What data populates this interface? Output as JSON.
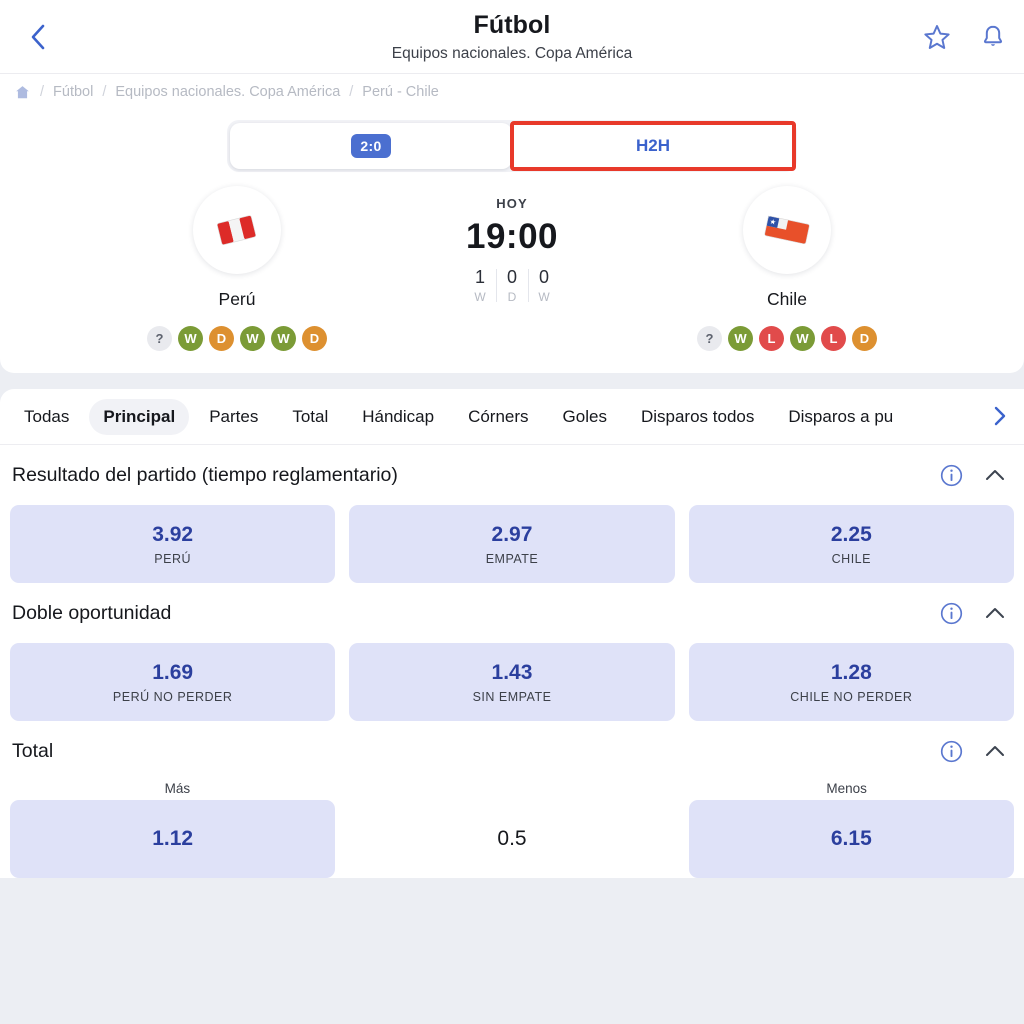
{
  "header": {
    "back_icon": "chevron-left-icon",
    "title": "Fútbol",
    "subtitle": "Equipos nacionales. Copa América",
    "favorite_icon": "star-icon",
    "notification_icon": "bell-icon"
  },
  "breadcrumb": {
    "home_icon": "home-icon",
    "sep": "/",
    "items": [
      {
        "label": "Fútbol"
      },
      {
        "label": "Equipos nacionales. Copa América"
      },
      {
        "label": "Perú - Chile"
      }
    ]
  },
  "segmented": {
    "tabs": [
      {
        "label": "2:0",
        "type": "score-badge",
        "active": true
      },
      {
        "label": "H2H",
        "type": "text",
        "active": false,
        "annotated": true
      }
    ]
  },
  "match": {
    "day_label": "HOY",
    "kickoff": "19:00",
    "stats": [
      {
        "value": "1",
        "key": "W"
      },
      {
        "value": "0",
        "key": "D"
      },
      {
        "value": "0",
        "key": "W"
      }
    ],
    "home": {
      "name": "Perú",
      "flag_icon": "peru-flag-icon",
      "form": [
        "?",
        "W",
        "D",
        "W",
        "W",
        "D"
      ]
    },
    "away": {
      "name": "Chile",
      "flag_icon": "chile-flag-icon",
      "form": [
        "?",
        "W",
        "L",
        "W",
        "L",
        "D"
      ]
    }
  },
  "market_tabs": [
    {
      "label": "Todas",
      "active": false
    },
    {
      "label": "Principal",
      "active": true
    },
    {
      "label": "Partes",
      "active": false
    },
    {
      "label": "Total",
      "active": false
    },
    {
      "label": "Hándicap",
      "active": false
    },
    {
      "label": "Córners",
      "active": false
    },
    {
      "label": "Goles",
      "active": false
    },
    {
      "label": "Disparos todos",
      "active": false
    },
    {
      "label": "Disparos a pu",
      "active": false
    }
  ],
  "market_tabs_more_icon": "chevron-right-icon",
  "markets": [
    {
      "title": "Resultado del partido (tiempo reglamentario)",
      "info_icon": "info-icon",
      "collapse_icon": "chevron-up-icon",
      "outcomes": [
        {
          "odds": "3.92",
          "label": "PERÚ"
        },
        {
          "odds": "2.97",
          "label": "EMPATE"
        },
        {
          "odds": "2.25",
          "label": "CHILE"
        }
      ]
    },
    {
      "title": "Doble oportunidad",
      "info_icon": "info-icon",
      "collapse_icon": "chevron-up-icon",
      "outcomes": [
        {
          "odds": "1.69",
          "label": "PERÚ NO PERDER"
        },
        {
          "odds": "1.43",
          "label": "SIN EMPATE"
        },
        {
          "odds": "1.28",
          "label": "CHILE NO PERDER"
        }
      ]
    }
  ],
  "total_market": {
    "title": "Total",
    "info_icon": "info-icon",
    "collapse_icon": "chevron-up-icon",
    "col_over": "Más",
    "col_under": "Menos",
    "over_odds": "1.12",
    "line": "0.5",
    "under_odds": "6.15"
  },
  "colors": {
    "accent_blue": "#3b62cc",
    "odds_text": "#2b3f9e",
    "odds_bg": "#dfe2f8",
    "annotation_red": "#e8392a",
    "win_green": "#7b9b36",
    "draw_orange": "#dd9030",
    "loss_red": "#e14b4b"
  }
}
